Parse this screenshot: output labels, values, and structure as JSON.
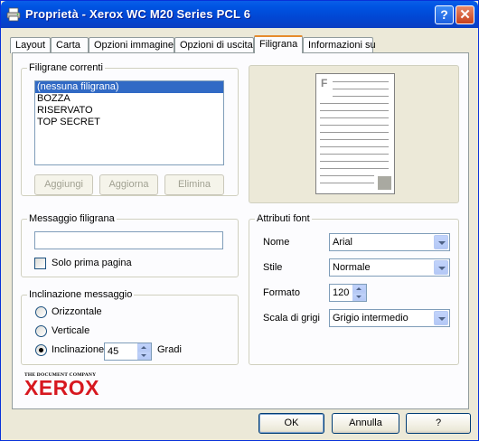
{
  "window": {
    "title": "Proprietà - Xerox WC M20 Series PCL 6",
    "help_glyph": "?",
    "close_glyph": "✕",
    "title_icon": "printer-icon"
  },
  "tabs": [
    {
      "label": "Layout"
    },
    {
      "label": "Carta"
    },
    {
      "label": "Opzioni immagine"
    },
    {
      "label": "Opzioni di uscita"
    },
    {
      "label": "Filigrana",
      "active": true
    },
    {
      "label": "Informazioni su"
    }
  ],
  "watermarks": {
    "group_label": "Filigrane correnti",
    "items": [
      "(nessuna filigrana)",
      "BOZZA",
      "RISERVATO",
      "TOP SECRET"
    ],
    "selected_index": 0,
    "add_label": "Aggiungi",
    "update_label": "Aggiorna",
    "delete_label": "Elimina"
  },
  "message": {
    "group_label": "Messaggio filigrana",
    "value": "",
    "first_page_label": "Solo prima pagina",
    "first_page_checked": false
  },
  "angle": {
    "group_label": "Inclinazione messaggio",
    "horizontal_label": "Orizzontale",
    "vertical_label": "Verticale",
    "angle_label": "Inclinazione",
    "angle_value": "45",
    "unit_label": "Gradi",
    "selected": "angle"
  },
  "font": {
    "group_label": "Attributi font",
    "name_label": "Nome",
    "name_value": "Arial",
    "style_label": "Stile",
    "style_value": "Normale",
    "size_label": "Formato",
    "size_value": "120",
    "gray_label": "Scala di grigi",
    "gray_value": "Grigio intermedio"
  },
  "preview": {
    "corner_letter": "F"
  },
  "logo": {
    "tagline": "THE DOCUMENT COMPANY",
    "brand": "XEROX",
    "brand_color": "#d7181f"
  },
  "footer": {
    "ok_label": "OK",
    "cancel_label": "Annulla",
    "help_label": "?"
  },
  "colors": {
    "accent": "#316ac5",
    "title_bar": "#0054e3"
  }
}
